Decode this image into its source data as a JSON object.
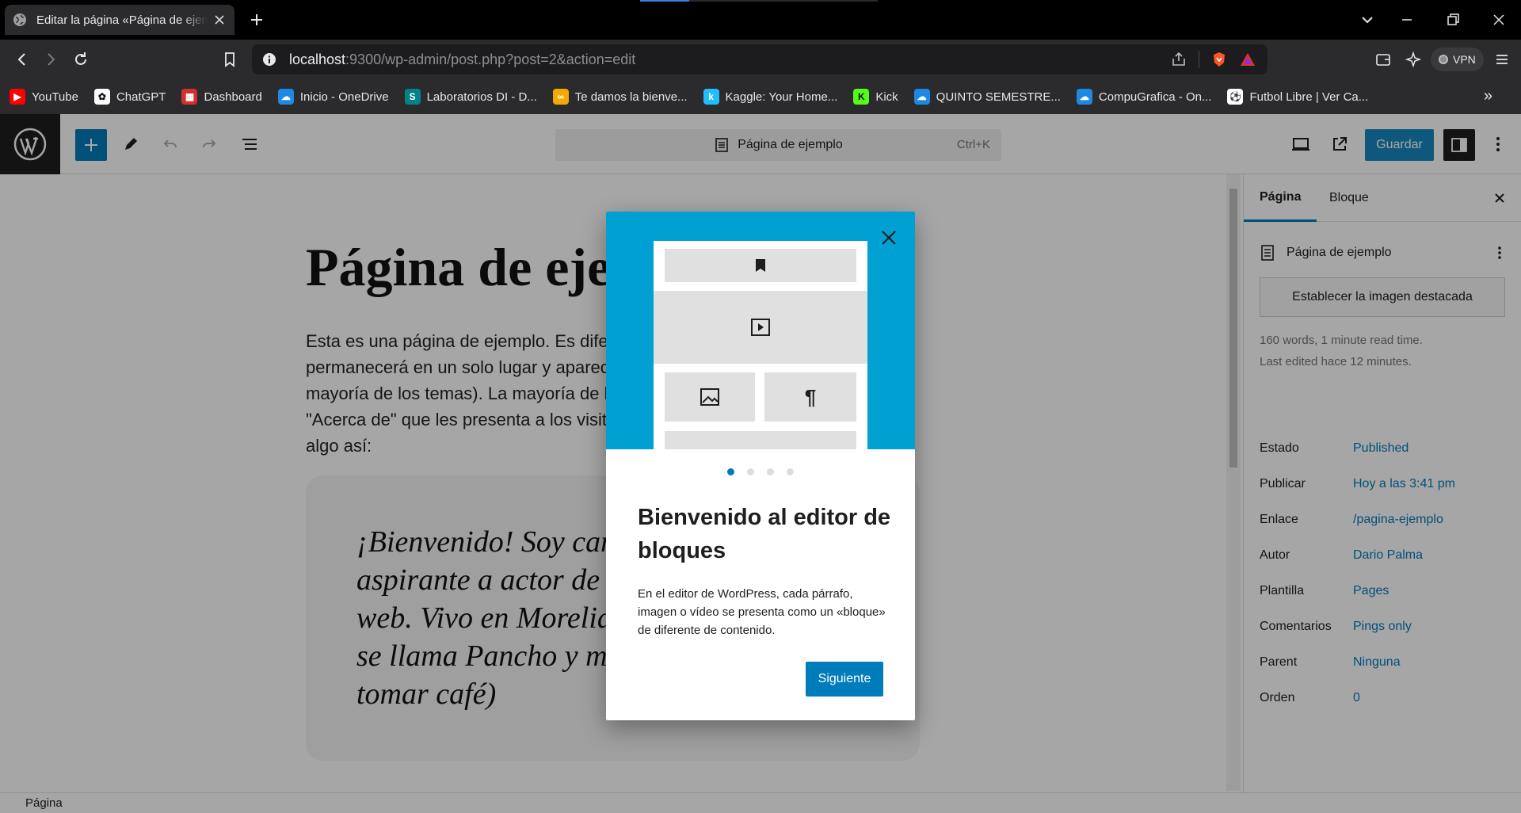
{
  "browser": {
    "tab_title": "Editar la página «Página de ejemplo» ‹ WordPress",
    "url_host": "localhost",
    "url_rest": ":9300/wp-admin/post.php?post=2&action=edit",
    "vpn_label": "VPN",
    "bookmarks": [
      {
        "label": "YouTube",
        "icon": "youtube-icon",
        "color": "#ff0000"
      },
      {
        "label": "ChatGPT",
        "icon": "chatgpt-icon",
        "color": "#ffffff"
      },
      {
        "label": "Dashboard",
        "icon": "dashboard-icon",
        "color": "#d32f2f"
      },
      {
        "label": "Inicio - OneDrive",
        "icon": "onedrive-icon",
        "color": "#1e88e5"
      },
      {
        "label": "Laboratorios DI - D...",
        "icon": "sharepoint-icon",
        "color": "#038387"
      },
      {
        "label": "Te damos la bienve...",
        "icon": "coursera-icon",
        "color": "#f2a900"
      },
      {
        "label": "Kaggle: Your Home...",
        "icon": "kaggle-icon",
        "color": "#20beff"
      },
      {
        "label": "Kick",
        "icon": "kick-icon",
        "color": "#53fc18"
      },
      {
        "label": "QUINTO SEMESTRE...",
        "icon": "onedrive-icon",
        "color": "#1e88e5"
      },
      {
        "label": "CompuGrafica - On...",
        "icon": "onedrive-icon",
        "color": "#1e88e5"
      },
      {
        "label": "Futbol Libre | Ver Ca...",
        "icon": "soccer-ball-icon",
        "color": "#ffffff"
      }
    ]
  },
  "editor": {
    "command_bar_title": "Página de ejemplo",
    "command_bar_shortcut": "Ctrl+K",
    "save_label": "Guardar",
    "footer_breadcrumb": "Página"
  },
  "content": {
    "title": "Página de ejemplo",
    "paragraph": "Esta es una página de ejemplo. Es diferente a una entrada del blog porque permanecerá en un solo lugar y aparecerá en la navegación de tu sitio (en la mayoría de los temas). La mayoría de la gente empieza con una página de \"Acerca de\" que les presenta a los visitantes potenciales del sitio. Podría decir algo así:",
    "quote": "¡Bienvenido! Soy camarero de día, aspirante a actor de noche y esta es mi web. Vivo en Morelia, tengo un perro que se llama Pancho y me gusta el mezcal. (Y tomar café)"
  },
  "sidebar": {
    "tab_page": "Página",
    "tab_block": "Bloque",
    "page_title": "Página de ejemplo",
    "featured_image_button": "Establecer la imagen destacada",
    "stats_words": "160 words, 1 minute read time.",
    "stats_edited": "Last edited hace 12 minutes.",
    "rows": [
      {
        "label": "Estado",
        "value": "Published"
      },
      {
        "label": "Publicar",
        "value": "Hoy a las 3:41 pm"
      },
      {
        "label": "Enlace",
        "value": "/pagina-ejemplo"
      },
      {
        "label": "Autor",
        "value": "Dario Palma"
      },
      {
        "label": "Plantilla",
        "value": "Pages"
      },
      {
        "label": "Comentarios",
        "value": "Pings only"
      },
      {
        "label": "Parent",
        "value": "Ninguna"
      },
      {
        "label": "Orden",
        "value": "0"
      }
    ]
  },
  "welcome_modal": {
    "heading": "Bienvenido al editor de bloques",
    "body": "En el editor de WordPress, cada párrafo, imagen o vídeo se presenta como un «bloque» de diferente de contenido.",
    "next_label": "Siguiente",
    "page_count": 4,
    "current_page": 1
  },
  "colors": {
    "accent": "#007cba",
    "hero_background": "#00a0d2",
    "wp_dark": "#1e1e1e"
  }
}
